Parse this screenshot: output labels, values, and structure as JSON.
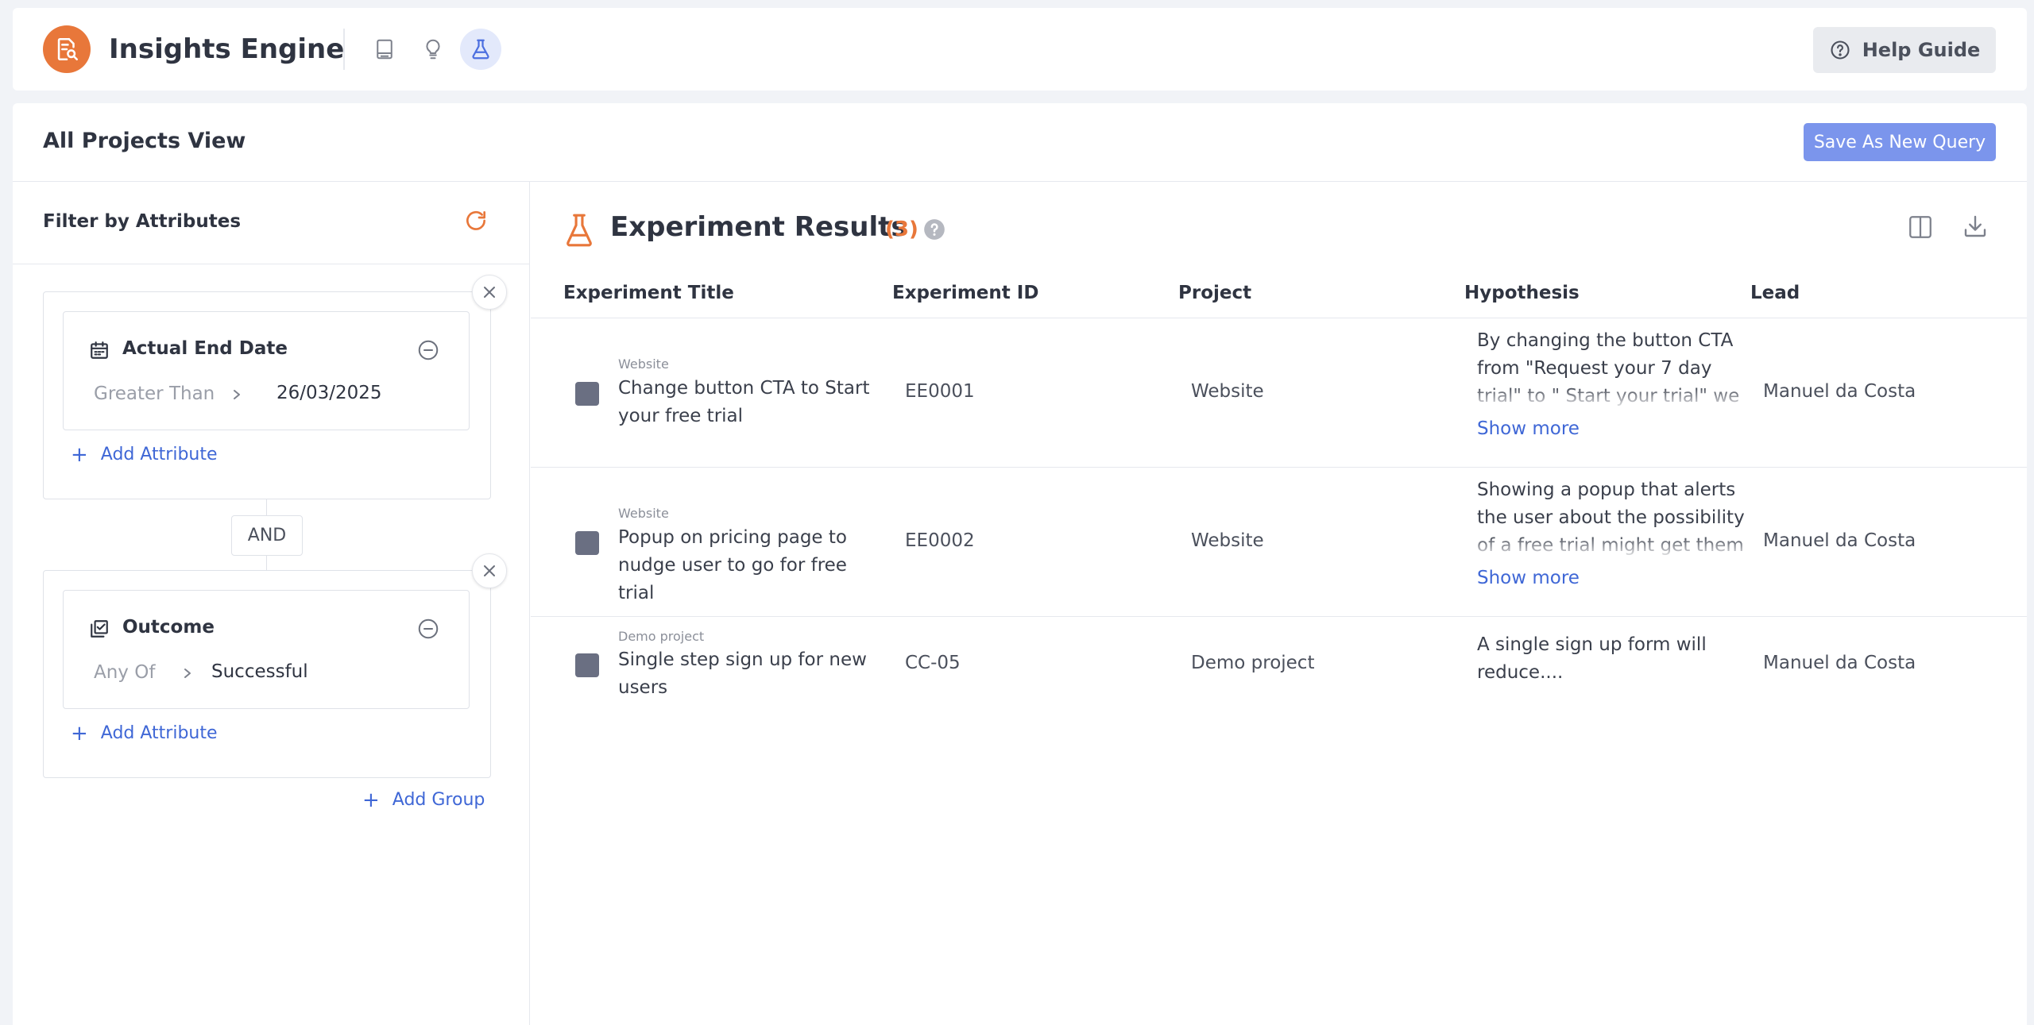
{
  "app": {
    "title": "Insights Engine"
  },
  "header": {
    "help_label": "Help Guide"
  },
  "page": {
    "title": "All Projects View",
    "save_label": "Save As New Query"
  },
  "filters": {
    "title": "Filter by Attributes",
    "join_label": "AND",
    "add_attribute_label": "Add Attribute",
    "add_group_label": "Add Group",
    "groups": [
      {
        "attribute": "Actual End Date",
        "operator": "Greater Than",
        "value": "26/03/2025"
      },
      {
        "attribute": "Outcome",
        "operator": "Any Of",
        "value": "Successful"
      }
    ]
  },
  "results": {
    "title": "Experiment Results",
    "count": "(3)",
    "columns": [
      "Experiment Title",
      "Experiment ID",
      "Project",
      "Hypothesis",
      "Lead"
    ],
    "show_more_label": "Show more",
    "rows": [
      {
        "project_tag": "Website",
        "title": "Change button CTA to Start your free trial",
        "id": "EE0001",
        "project": "Website",
        "hypothesis": "By changing the button CTA from \"Request your 7 day trial\" to \" Start your trial\" we will increase the contact",
        "lead": "Manuel da Costa"
      },
      {
        "project_tag": "Website",
        "title": "Popup on pricing page to nudge user to go for free trial",
        "id": "EE0002",
        "project": "Website",
        "hypothesis": "Showing a popup that alerts the user about the possibility of a free trial might get them to get to",
        "lead": "Manuel da Costa"
      },
      {
        "project_tag": "Demo project",
        "title": "Single step sign up for new users",
        "id": "CC-05",
        "project": "Demo project",
        "hypothesis": "A single sign up form will reduce....",
        "lead": "Manuel da Costa"
      }
    ]
  },
  "colors": {
    "accent": "#e8773a",
    "primary": "#7b95ec",
    "link": "#3f67d6"
  }
}
